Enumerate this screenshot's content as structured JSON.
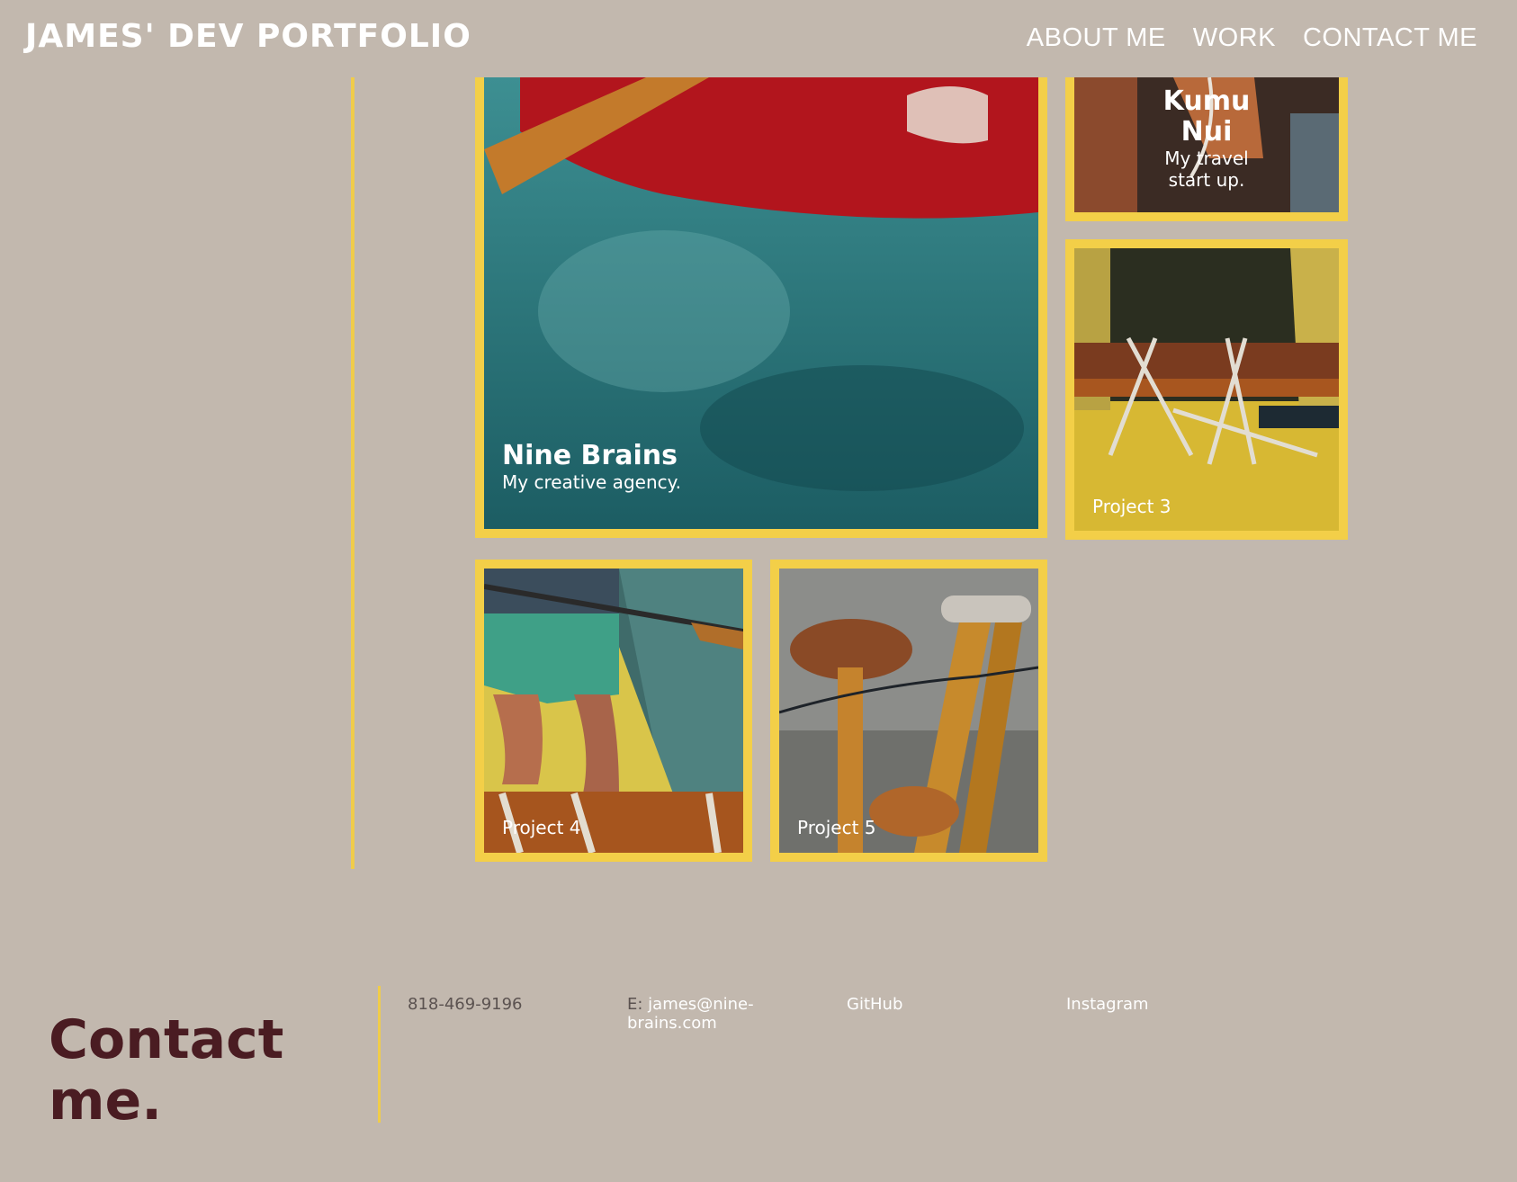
{
  "header": {
    "logo": "JAMES' DEV PORTFOLIO",
    "nav": [
      "ABOUT ME",
      "WORK",
      "CONTACT ME"
    ]
  },
  "projects": [
    {
      "title": "Nine Brains",
      "subtitle": "My creative agency."
    },
    {
      "title": "Kumu Nui",
      "subtitle": "My travel start up."
    },
    {
      "title": "Project 3"
    },
    {
      "title": "Project 4"
    },
    {
      "title": "Project 5"
    }
  ],
  "footer": {
    "heading": "Contact me.",
    "phone": "818-469-9196",
    "email_label": "E:",
    "email": "james@nine-brains.com",
    "github": "GitHub",
    "instagram": "Instagram"
  },
  "colors": {
    "background": "#c2b8ae",
    "accent": "#f3cf48",
    "heading": "#4a1c22"
  }
}
